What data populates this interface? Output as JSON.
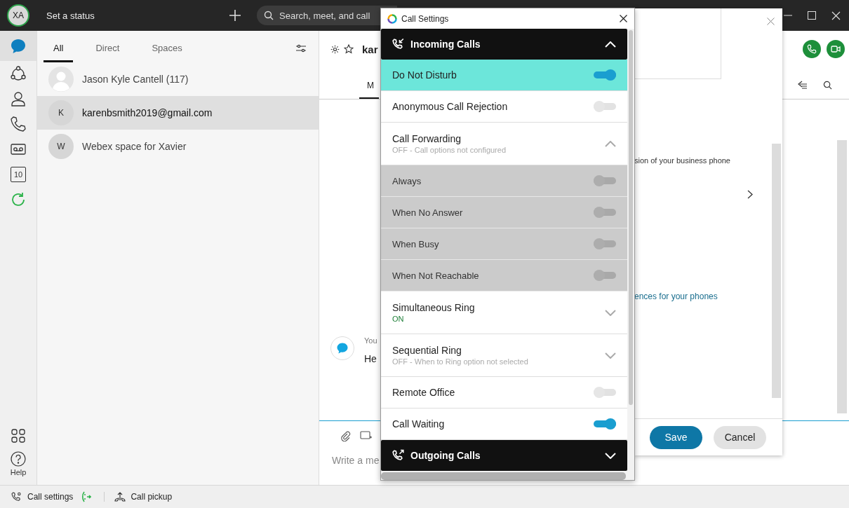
{
  "top_bar": {
    "avatar": "XA",
    "status": "Set a status",
    "search": {
      "placeholder": "Search, meet, and call"
    }
  },
  "rail": {
    "items": [
      {
        "kind": "messaging",
        "selected": true
      },
      {
        "kind": "teams",
        "selected": false
      },
      {
        "kind": "contacts",
        "selected": false
      },
      {
        "kind": "calls",
        "selected": false
      },
      {
        "kind": "voicemail",
        "selected": false
      },
      {
        "kind": "calendar",
        "label": "10",
        "selected": false
      },
      {
        "kind": "refresh",
        "selected": false
      }
    ],
    "bottom": [
      {
        "kind": "apps"
      },
      {
        "kind": "help",
        "label": "Help"
      }
    ]
  },
  "tabs": [
    {
      "label": "All",
      "selected": true
    },
    {
      "label": "Direct",
      "selected": false
    },
    {
      "label": "Spaces",
      "selected": false
    }
  ],
  "conversations": [
    {
      "kind": "silhouette",
      "name": "Jason Kyle Cantell (117)",
      "selected": false
    },
    {
      "kind": "initial",
      "initial": "K",
      "name": "karenbsmith2019@gmail.com",
      "selected": true
    },
    {
      "kind": "initial",
      "initial": "W",
      "name": "Webex space for Xavier",
      "selected": false
    }
  ],
  "space": {
    "title": "kar",
    "tab": "M",
    "message": {
      "sender": "You",
      "text": "He"
    },
    "composer": {
      "placeholder": "Write a me"
    }
  },
  "settings_panel": {
    "description": "sion of your business phone",
    "link": "ences for your phones",
    "buttons": [
      {
        "label": "Save",
        "kind": "primary"
      },
      {
        "label": "Cancel",
        "kind": "secondary"
      }
    ]
  },
  "call_settings": {
    "title": "Call Settings",
    "sections": [
      {
        "title": "Incoming Calls",
        "expanded": true,
        "items": [
          {
            "kind": "toggle",
            "label": "Do Not Disturb",
            "on": true,
            "highlighted": true
          },
          {
            "kind": "toggle",
            "label": "Anonymous Call Rejection",
            "on": false,
            "highlighted": false
          },
          {
            "kind": "expander",
            "label": "Call Forwarding",
            "status": "OFF - Call options not configured",
            "active": false,
            "expanded": true,
            "highlighted": false,
            "children": [
              {
                "label": "Always",
                "on": false,
                "disabled": true
              },
              {
                "label": "When No Answer",
                "on": false,
                "disabled": true
              },
              {
                "label": "When Busy",
                "on": false,
                "disabled": true
              },
              {
                "label": "When Not Reachable",
                "on": false,
                "disabled": true
              }
            ]
          },
          {
            "kind": "expander",
            "label": "Simultaneous Ring",
            "status": "ON",
            "active": true,
            "expanded": false,
            "highlighted": false
          },
          {
            "kind": "expander",
            "label": "Sequential Ring",
            "status": "OFF - When to Ring option not selected",
            "active": false,
            "expanded": false,
            "highlighted": false
          },
          {
            "kind": "toggle",
            "label": "Remote Office",
            "on": false,
            "highlighted": false
          },
          {
            "kind": "toggle",
            "label": "Call Waiting",
            "on": true,
            "highlighted": false
          }
        ]
      },
      {
        "title": "Outgoing Calls",
        "expanded": false
      }
    ]
  },
  "status_bar": {
    "items": [
      {
        "kind": "call-settings",
        "label": "Call settings"
      },
      {
        "kind": "call-pickup",
        "label": "Call pickup"
      }
    ]
  }
}
